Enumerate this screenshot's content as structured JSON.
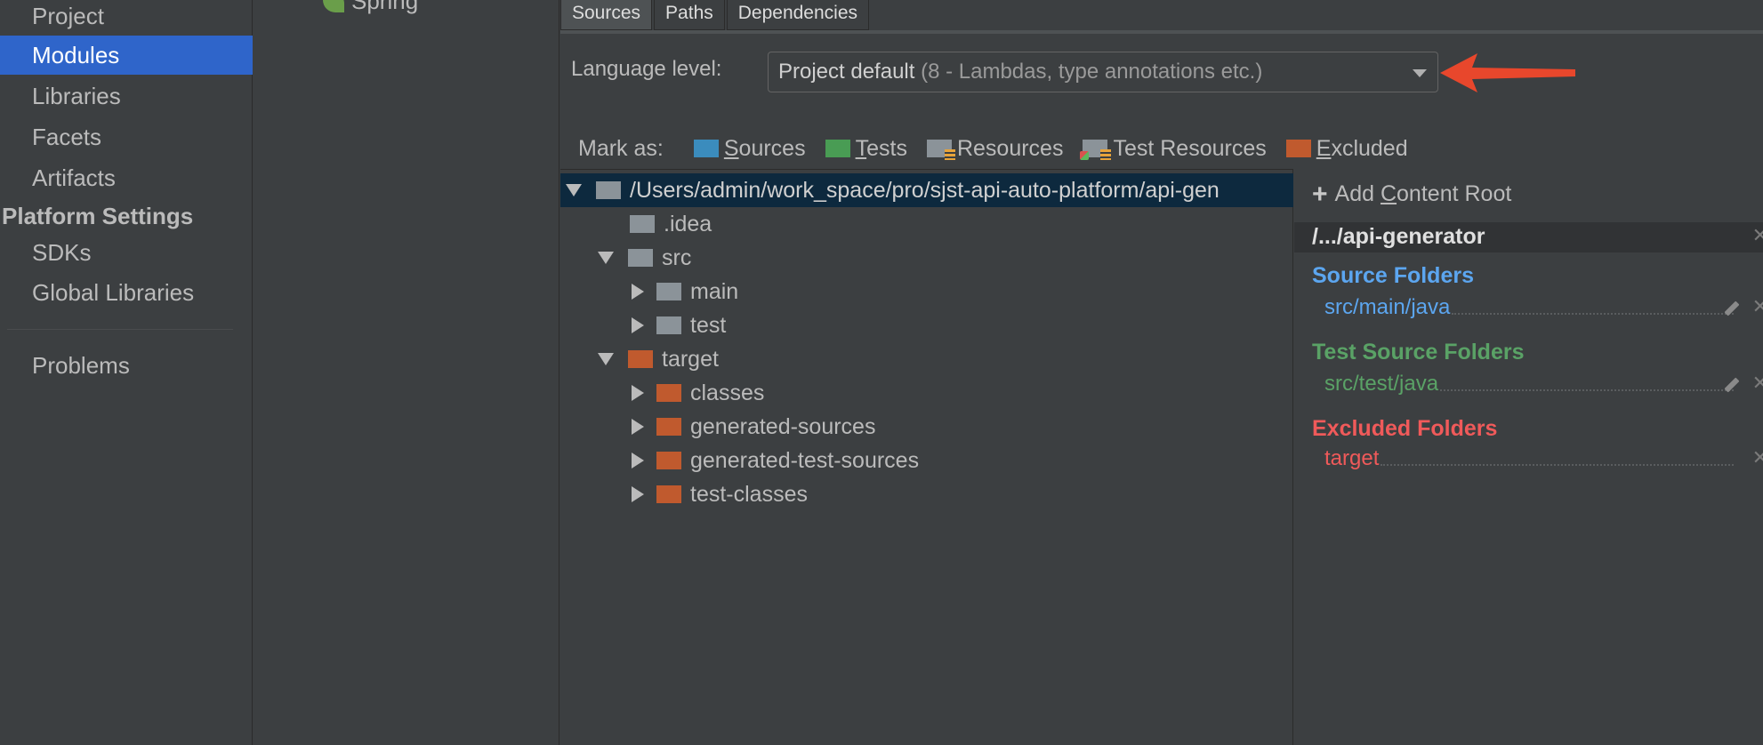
{
  "sidebar": {
    "items": [
      {
        "label": "Project",
        "selected": false
      },
      {
        "label": "Modules",
        "selected": true
      },
      {
        "label": "Libraries",
        "selected": false
      },
      {
        "label": "Facets",
        "selected": false
      },
      {
        "label": "Artifacts",
        "selected": false
      }
    ],
    "platform_header": "Platform Settings",
    "platform_items": [
      {
        "label": "SDKs"
      },
      {
        "label": "Global Libraries"
      }
    ],
    "problems": "Problems"
  },
  "modules": {
    "spring_label": "Spring",
    "spring_icon": "spring-leaf-icon"
  },
  "tabs": [
    {
      "label": "Sources",
      "active": true
    },
    {
      "label": "Paths",
      "active": false
    },
    {
      "label": "Dependencies",
      "active": false
    }
  ],
  "language_level": {
    "label": "Language level:",
    "value": "Project default",
    "hint": "(8 - Lambdas, type annotations etc.)"
  },
  "mark_as": {
    "label": "Mark as:",
    "buttons": [
      {
        "mnemonic": "S",
        "rest": "ources",
        "icon": "sources-folder-icon"
      },
      {
        "mnemonic": "T",
        "rest": "ests",
        "icon": "tests-folder-icon"
      },
      {
        "mnemonic": "",
        "rest": "Resources",
        "icon": "resources-folder-icon"
      },
      {
        "mnemonic": "",
        "rest": "Test Resources",
        "icon": "test-resources-folder-icon"
      },
      {
        "mnemonic": "E",
        "rest": "xcluded",
        "icon": "excluded-folder-icon"
      }
    ]
  },
  "tree": {
    "root": "/Users/admin/work_space/pro/sjst-api-auto-platform/api-gen",
    "nodes": [
      {
        "label": ".idea"
      },
      {
        "label": "src"
      },
      {
        "label": "main"
      },
      {
        "label": "test"
      },
      {
        "label": "target"
      },
      {
        "label": "classes"
      },
      {
        "label": "generated-sources"
      },
      {
        "label": "generated-test-sources"
      },
      {
        "label": "test-classes"
      }
    ]
  },
  "content_root": {
    "add_label_pre": "Add ",
    "add_mnemonic": "C",
    "add_label_post": "ontent Root",
    "root_title": "/.../api-generator",
    "source_folders_title": "Source Folders",
    "source_folder": "src/main/java",
    "test_folders_title": "Test Source Folders",
    "test_folder": "src/test/java",
    "excluded_title": "Excluded Folders",
    "excluded_folder": "target"
  },
  "colors": {
    "selection": "#2f65ca",
    "source": "#5ca6f0",
    "test": "#5aa266",
    "excluded": "#f05a5a",
    "arrow": "#e8472c"
  }
}
